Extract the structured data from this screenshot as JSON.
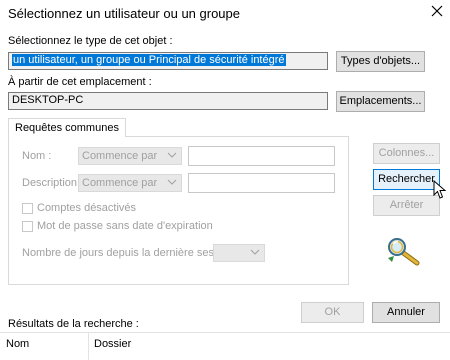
{
  "dialog": {
    "title": "Sélectionnez un utilisateur ou un groupe"
  },
  "object_type": {
    "label": "Sélectionnez le type de cet objet :",
    "value": "un utilisateur, un groupe ou Principal de sécurité intégré",
    "button": "Types d'objets..."
  },
  "location": {
    "label": "À partir de cet emplacement :",
    "value": "DESKTOP-PC",
    "button": "Emplacements..."
  },
  "queries": {
    "tab": "Requêtes communes",
    "name_label": "Nom :",
    "name_op": "Commence par",
    "desc_label": "Description :",
    "desc_op": "Commence par",
    "disabled_accounts": "Comptes désactivés",
    "no_expiry": "Mot de passe sans date d'expiration",
    "days_label": "Nombre de jours depuis la dernière session :"
  },
  "side_buttons": {
    "columns": "Colonnes...",
    "search": "Rechercher",
    "stop": "Arrêter"
  },
  "footer": {
    "ok": "OK",
    "cancel": "Annuler"
  },
  "results": {
    "label": "Résultats de la recherche :",
    "columns": [
      "Nom",
      "Dossier"
    ]
  },
  "colors": {
    "selection": "#0078d7",
    "disabled_text": "#a0a0a0"
  },
  "icons": {
    "close": "close-icon",
    "search_graphic": "magnifier-search-icon",
    "cursor": "mouse-pointer-icon"
  }
}
